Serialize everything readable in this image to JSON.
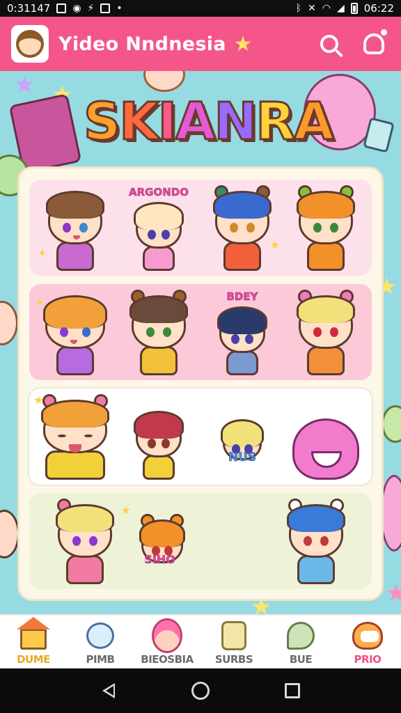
{
  "status_bar": {
    "time_left": "0:31147",
    "time_right": "06:22"
  },
  "app_bar": {
    "title": "Yideo Nndnesia"
  },
  "banner": {
    "letters": [
      "S",
      "K",
      "I",
      "A",
      "N",
      "R",
      "A"
    ]
  },
  "stickers": {
    "row1": {
      "label": "ARGONDO"
    },
    "row2": {
      "label": "BDEY"
    },
    "row3": {
      "label": "NUS"
    },
    "row4": {
      "label": "SIHO"
    }
  },
  "bottom_nav": {
    "items": [
      {
        "label": "DUME",
        "icon": "house-icon"
      },
      {
        "label": "PIMB",
        "icon": "chat-bubble-icon"
      },
      {
        "label": "BIEOSBIA",
        "icon": "character-face-icon"
      },
      {
        "label": "SURBS",
        "icon": "scroll-icon"
      },
      {
        "label": "BUE",
        "icon": "leaf-icon"
      },
      {
        "label": "PRIO",
        "icon": "blob-mascot-icon"
      }
    ]
  },
  "colors": {
    "app_bar": "#f4568a",
    "background": "#97dbe2",
    "panel": "#fdf7e8"
  }
}
